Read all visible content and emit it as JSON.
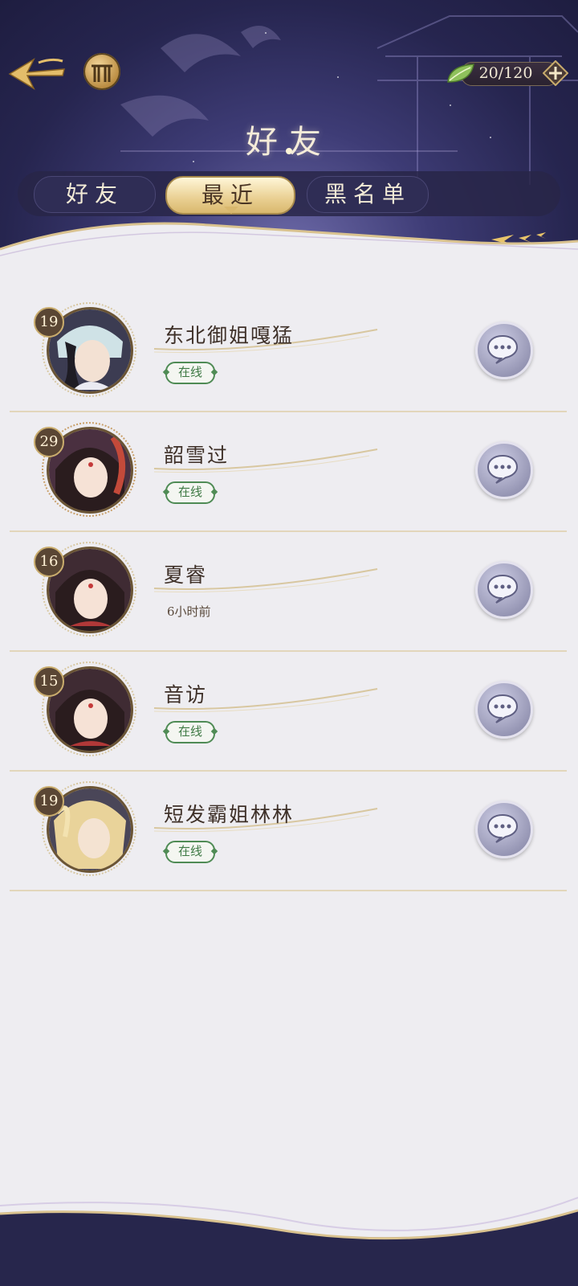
{
  "header": {
    "title": "好友",
    "currency": {
      "icon": "leaf-icon",
      "value": "20/120"
    }
  },
  "tabs": [
    {
      "label": "好友",
      "active": false
    },
    {
      "label": "最近",
      "active": true
    },
    {
      "label": "黑名单",
      "active": false
    }
  ],
  "friends": [
    {
      "level": "19",
      "name": "东北御姐嘎猛",
      "status": "在线",
      "online": true
    },
    {
      "level": "29",
      "name": "韶雪过",
      "status": "在线",
      "online": true
    },
    {
      "level": "16",
      "name": "夏睿",
      "status": "6小时前",
      "online": false
    },
    {
      "level": "15",
      "name": "音访",
      "status": "在线",
      "online": true
    },
    {
      "level": "19",
      "name": "短发霸姐林林",
      "status": "在线",
      "online": true
    }
  ],
  "colors": {
    "accent_gold": "#d9b86e",
    "online_green": "#4f8b55",
    "header_navy": "#26254f"
  }
}
